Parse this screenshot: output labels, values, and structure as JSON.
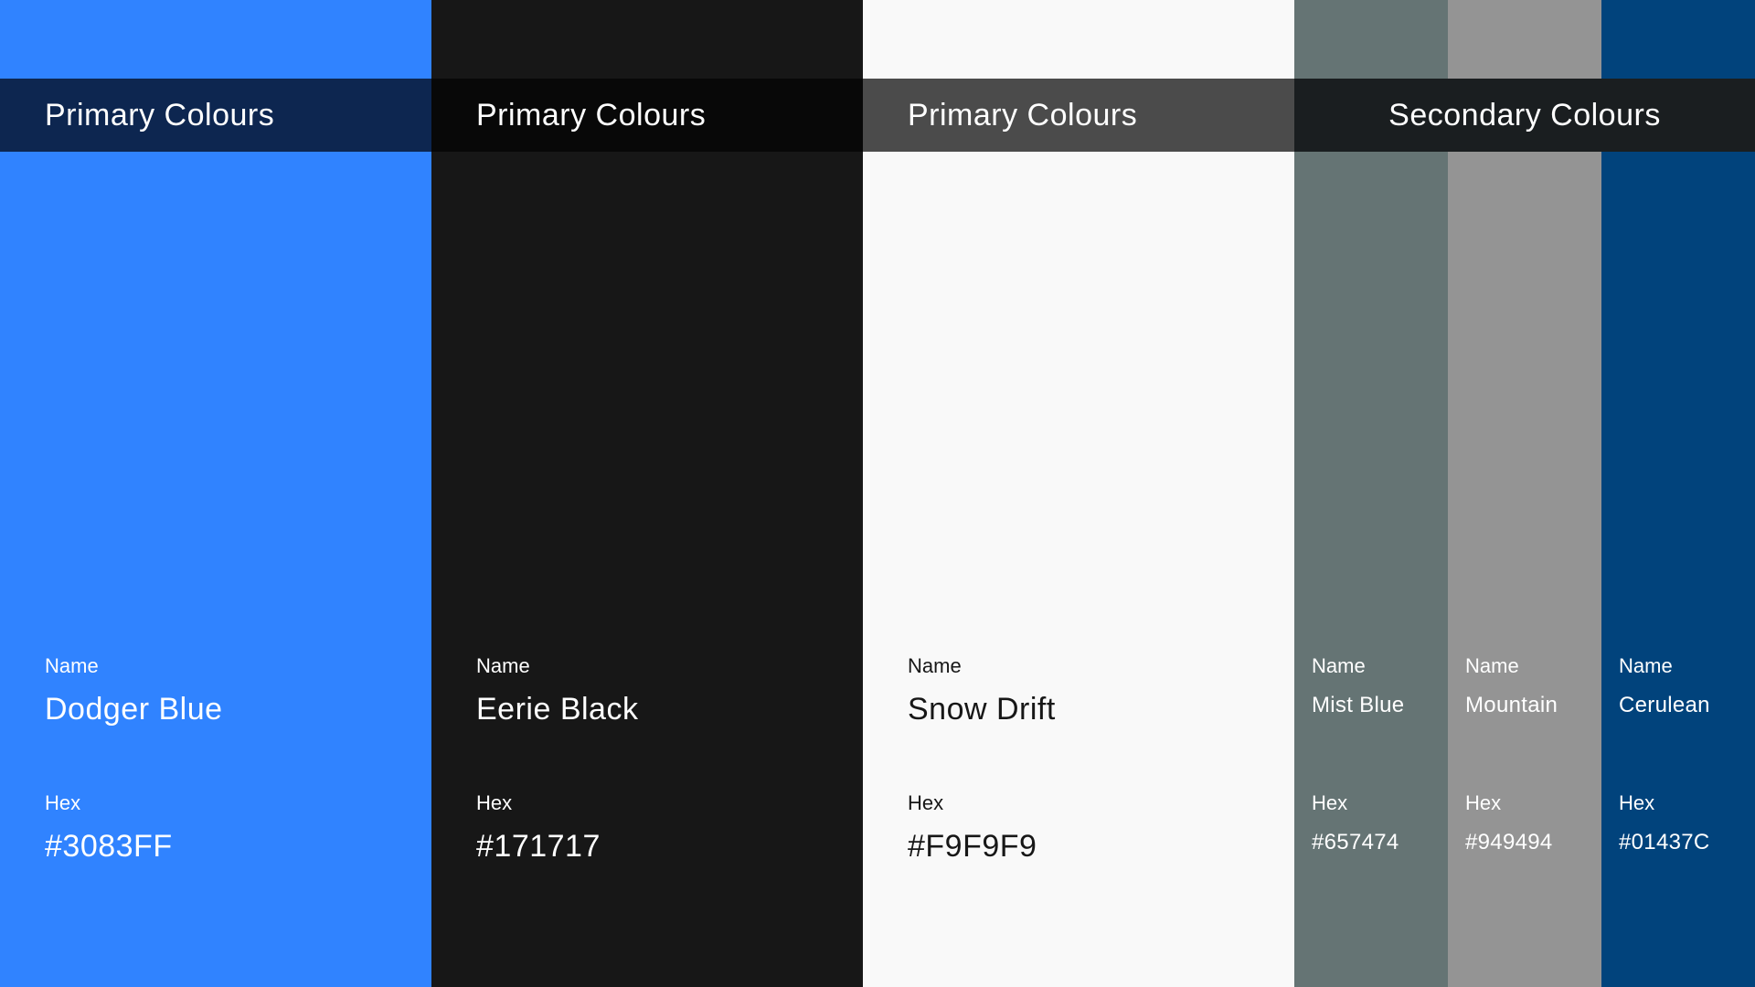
{
  "bands": [
    {
      "title": "Primary Colours",
      "background": "#0D2650",
      "text_color": "#FFFFFF"
    },
    {
      "title": "Primary Colours",
      "background": "#080808",
      "text_color": "#FFFFFF"
    },
    {
      "title": "Primary Colours",
      "background": "#4B4B4B",
      "text_color": "#FFFFFF"
    },
    {
      "title": "Secondary Colours",
      "background": "#1A1E20",
      "text_color": "#FFFFFF"
    }
  ],
  "swatches": [
    {
      "name_label": "Name",
      "name": "Dodger Blue",
      "hex_label": "Hex",
      "hex": "#3083FF",
      "color": "#3083FF",
      "text_color": "#FFFFFF",
      "size": "big"
    },
    {
      "name_label": "Name",
      "name": "Eerie Black",
      "hex_label": "Hex",
      "hex": "#171717",
      "color": "#171717",
      "text_color": "#FFFFFF",
      "size": "big"
    },
    {
      "name_label": "Name",
      "name": "Snow Drift",
      "hex_label": "Hex",
      "hex": "#F9F9F9",
      "color": "#F9F9F9",
      "text_color": "#171717",
      "size": "big"
    },
    {
      "name_label": "Name",
      "name": "Mist Blue",
      "hex_label": "Hex",
      "hex": "#657474",
      "color": "#657474",
      "text_color": "#FFFFFF",
      "size": "small"
    },
    {
      "name_label": "Name",
      "name": "Mountain",
      "hex_label": "Hex",
      "hex": "#949494",
      "color": "#949494",
      "text_color": "#FFFFFF",
      "size": "small"
    },
    {
      "name_label": "Name",
      "name": "Cerulean",
      "hex_label": "Hex",
      "hex": "#01437C",
      "color": "#01437C",
      "text_color": "#FFFFFF",
      "size": "small"
    }
  ]
}
